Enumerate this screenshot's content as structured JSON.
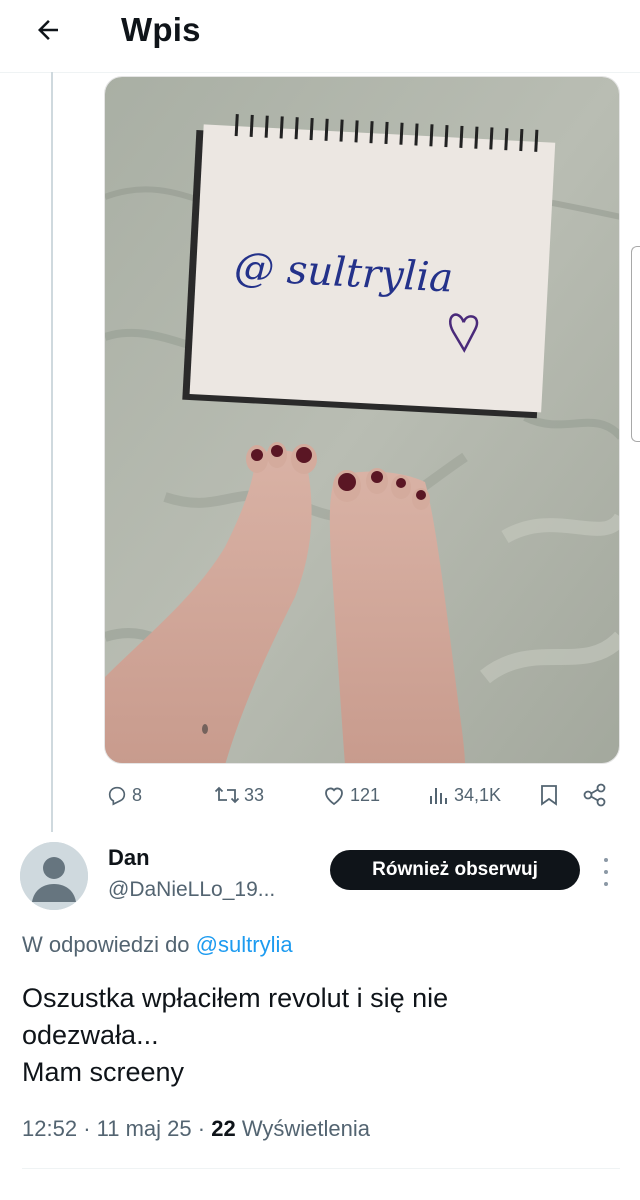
{
  "header": {
    "title": "Wpis",
    "back_icon": "arrow-left-icon"
  },
  "post": {
    "media": {
      "notebook_text": "@ sultrylia",
      "has_heart_doodle": true
    },
    "actions": {
      "replies": "8",
      "reposts": "33",
      "likes": "121",
      "views": "34,1K"
    },
    "icons": [
      "reply-icon",
      "repost-icon",
      "like-icon",
      "views-icon",
      "bookmark-icon",
      "share-icon"
    ]
  },
  "reply": {
    "name": "Dan",
    "handle": "@DaNieLLo_19...",
    "follow_label": "Również obserwuj",
    "replying_to_prefix": "W odpowiedzi do",
    "replying_to_user": "@sultrylia",
    "text_lines": [
      "Oszustka wpłaciłem revolut i się nie",
      "odezwała...",
      "Mam screeny"
    ],
    "time": "12:52",
    "date": "11 maj 25",
    "views_count": "22",
    "views_label": "Wyświetlenia"
  },
  "colors": {
    "accent": "#1d9bf0",
    "text_primary": "#0f1419",
    "text_secondary": "#536471",
    "follow_bg": "#0f1419"
  }
}
